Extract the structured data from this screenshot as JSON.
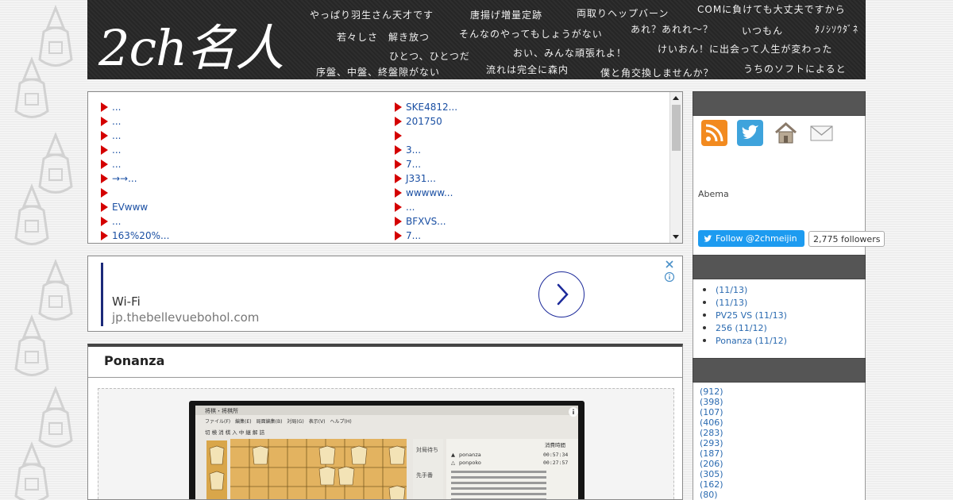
{
  "header": {
    "logo": "2ch名人",
    "catchphrases": [
      "やっぱり羽生さん天才です",
      "唐揚げ増量定跡",
      "両取りヘップバーン",
      "COMに負けても大丈夫ですから",
      "若々しさ　解き放つ",
      "そんなのやってもしょうがない",
      "あれ？あれれ〜？",
      "いつもん",
      "ﾀﾉｼｿｳﾀﾞﾈ",
      "ひとつ、ひとつだ",
      "おい、みんな頑張れよ！",
      "けいおん！に出会って人生が変わった",
      "序盤、中盤、終盤隙がない",
      "流れは完全に森内",
      "僕と角交換しませんか？",
      "うちのソフトによると"
    ]
  },
  "news": {
    "left": [
      "...",
      "...",
      "...",
      "...",
      "...",
      "→→...",
      "",
      "EVwww",
      "...",
      "163%20%..."
    ],
    "right": [
      "SKE4812...",
      "201750",
      "",
      "3...",
      "7...",
      "J331...",
      "wwwww...",
      "...",
      "BFXVS...",
      "7..."
    ]
  },
  "ad": {
    "title": "Wi-Fi",
    "url": "jp.thebellevuebohol.com"
  },
  "article": {
    "title": "Ponanza",
    "screenshot": {
      "window_title": "将棋・将棋所",
      "menu": "ファイル(F)　編集(E)　局面編集(B)　対局(G)　表示(V)　ヘルプ(H)",
      "toolbar": "切 検 消 棋 入 中 継 解 詰",
      "status_label": "対局待ち",
      "turn_label": "先手番",
      "time_header": "消費時間",
      "player1": "ponanza",
      "player1_time": "00:57:34",
      "player2": "ponpoko",
      "player2_time": "00:27:57"
    }
  },
  "sidebar": {
    "social_icons": [
      "rss-icon",
      "twitter-icon",
      "home-icon",
      "mail-icon"
    ],
    "abema": "Abema",
    "follow_label": "Follow @2chmeijin",
    "followers": "2,775 followers",
    "recent": [
      " (11/13)",
      " (11/13)",
      "PV25 VS  (11/13)",
      "256 (11/12)",
      "Ponanza (11/12)"
    ],
    "categories": [
      "(912)",
      "(398)",
      "(107)",
      "(406)",
      "(283)",
      "(293)",
      "(187)",
      "(206)",
      "(305)",
      "(162)",
      "(80)"
    ]
  },
  "colors": {
    "link": "#1a4fa3",
    "bullet_arrow": "#d40000",
    "header_bg": "#2b2b2b",
    "twitter_blue": "#1d9bf0"
  }
}
